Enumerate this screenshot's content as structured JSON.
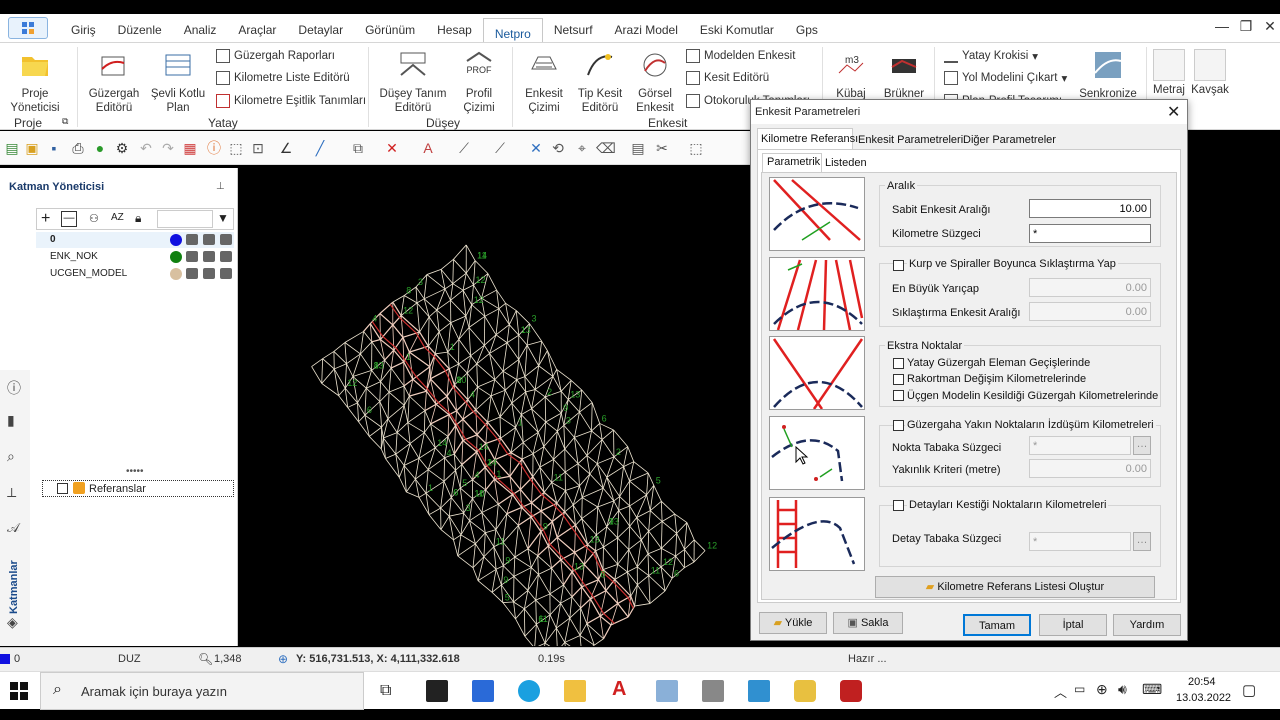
{
  "menu": [
    "Giriş",
    "Düzenle",
    "Analiz",
    "Araçlar",
    "Detaylar",
    "Görünüm",
    "Hesap",
    "Netpro",
    "Netsurf",
    "Arazi Model",
    "Eski Komutlar",
    "Gps"
  ],
  "menu_active": "Netpro",
  "ribbon": {
    "proje_yoneticisi": [
      "Proje",
      "Yöneticisi"
    ],
    "proje_group": "Proje",
    "guzergah_editoru": [
      "Güzergah",
      "Editörü"
    ],
    "sevli_kotlu_plan": [
      "Şevli Kotlu",
      "Plan"
    ],
    "guzergah_raporlari": "Güzergah Raporları",
    "kilometre_liste": "Kilometre Liste Editörü",
    "kilometre_esitlik": "Kilometre Eşitlik Tanımları",
    "yatay_group": "Yatay",
    "duşey_tanim": [
      "Düşey Tanım",
      "Editörü"
    ],
    "profil_cizimi": [
      "Profil",
      "Çizimi"
    ],
    "prof_text": "PROF",
    "dusey_group": "Düşey",
    "enkesit_cizimi": [
      "Enkesit",
      "Çizimi"
    ],
    "tip_kesit": [
      "Tip Kesit",
      "Editörü"
    ],
    "gorsel_enkesit": [
      "Görsel",
      "Enkesit"
    ],
    "modelden_enkesit": "Modelden Enkesit",
    "kesit_editoru": "Kesit Editörü",
    "otokoruluk": "Otokoruluk Tanımları",
    "enkesit_group": "Enkesit",
    "kubaj": "Kübaj",
    "kubaj_icon_text": "m3",
    "brukner": "Brükner",
    "yatay_kroki": "Yatay Krokisi",
    "yol_modeli": "Yol Modelini Çıkart",
    "plan_profil": "Plan-Profil Tasarımı",
    "senkronize": "Senkronize",
    "metraj": "Metraj",
    "kavsak": "Kavşak"
  },
  "layers": {
    "title": "Katman Yöneticisi",
    "items": [
      {
        "name": "0",
        "color": "#1010e0"
      },
      {
        "name": "ENK_NOK",
        "color": "#108010"
      },
      {
        "name": "UCGEN_MODEL",
        "color": "#d8c0a0"
      }
    ],
    "referanslar": "Referanslar",
    "side_tab": "Katmanlar"
  },
  "status": {
    "layer": "0",
    "mode": "DUZ",
    "zoom": "1,348",
    "coords": "Y: 516,731.513, X: 4,111,332.618",
    "time": "0.19s",
    "ready": "Hazır ..."
  },
  "taskbar": {
    "search": "Aramak için buraya yazın",
    "clock_time": "20:54",
    "clock_date": "13.03.2022"
  },
  "dialog": {
    "title": "Enkesit Parametreleri",
    "tabs": [
      "Kilometre Referansı",
      "Enkesit Parametreleri",
      "Diğer Parametreler"
    ],
    "subtabs": [
      "Parametrik",
      "Listeden"
    ],
    "aralik": "Aralık",
    "sabit_label": "Sabit Enkesit Aralığı",
    "sabit_value": "10.00",
    "km_suzgec_label": "Kilometre Süzgeci",
    "km_suzgec_value": "*",
    "kurp_label": "Kurp ve Spiraller Boyunca Sıklaştırma Yap",
    "en_buyuk_label": "En Büyük Yarıçap",
    "en_buyuk_value": "0.00",
    "siklastirma_label": "Sıklaştırma Enkesit Aralığı",
    "siklastirma_value": "0.00",
    "ekstra": "Ekstra Noktalar",
    "ekstra_items": [
      "Yatay Güzergah Eleman Geçişlerinde",
      "Rakortman Değişim Kilometrelerinde",
      "Üçgen Modelin Kesildiği Güzergah Kilometrelerinde"
    ],
    "izdusum_label": "Güzergaha Yakın Noktaların İzdüşüm Kilometreleri",
    "nokta_label": "Nokta Tabaka Süzgeci",
    "nokta_value": "*",
    "yakinlik_label": "Yakınlık Kriteri (metre)",
    "yakinlik_value": "0.00",
    "detay_label": "Detayları Kestiği Noktaların Kilometreleri",
    "detay_tabaka_label": "Detay Tabaka Süzgeci",
    "detay_tabaka_value": "*",
    "olustur": "Kilometre Referans Listesi Oluştur",
    "yukle": "Yükle",
    "sakla": "Sakla",
    "tamam": "Tamam",
    "iptal": "İptal",
    "yardim": "Yardım"
  }
}
